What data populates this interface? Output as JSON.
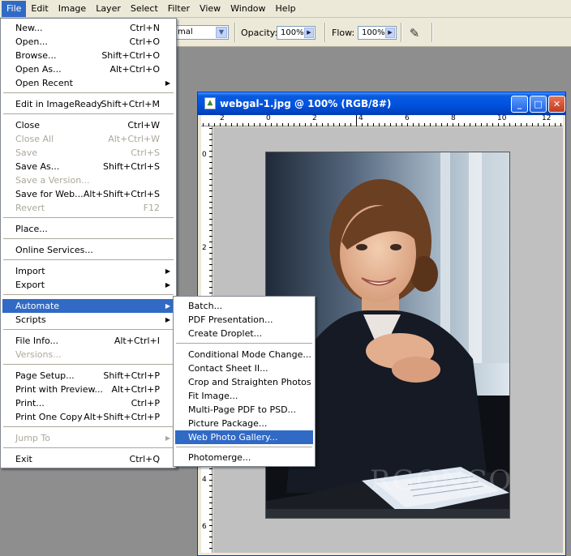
{
  "menubar": [
    "File",
    "Edit",
    "Image",
    "Layer",
    "Select",
    "Filter",
    "View",
    "Window",
    "Help"
  ],
  "options": {
    "mode_value": "mal",
    "opacity_label": "Opacity:",
    "opacity_value": "100%",
    "flow_label": "Flow:",
    "flow_value": "100%"
  },
  "document": {
    "title": "webgal-1.jpg @ 100% (RGB/8#)",
    "ruler_top": [
      "2",
      "0",
      "2",
      "4",
      "6",
      "8",
      "10",
      "12"
    ],
    "ruler_left": [
      "0",
      "2",
      "4",
      "6"
    ],
    "watermark": "RGONCO.COM"
  },
  "file_menu": {
    "g1": [
      {
        "label": "New...",
        "shortcut": "Ctrl+N"
      },
      {
        "label": "Open...",
        "shortcut": "Ctrl+O"
      },
      {
        "label": "Browse...",
        "shortcut": "Shift+Ctrl+O"
      },
      {
        "label": "Open As...",
        "shortcut": "Alt+Ctrl+O"
      },
      {
        "label": "Open Recent",
        "shortcut": ""
      }
    ],
    "g2": [
      {
        "label": "Edit in ImageReady",
        "shortcut": "Shift+Ctrl+M"
      }
    ],
    "g3": [
      {
        "label": "Close",
        "shortcut": "Ctrl+W"
      },
      {
        "label": "Close All",
        "shortcut": "Alt+Ctrl+W"
      },
      {
        "label": "Save",
        "shortcut": "Ctrl+S"
      },
      {
        "label": "Save As...",
        "shortcut": "Shift+Ctrl+S"
      },
      {
        "label": "Save a Version...",
        "shortcut": ""
      },
      {
        "label": "Save for Web...",
        "shortcut": "Alt+Shift+Ctrl+S"
      },
      {
        "label": "Revert",
        "shortcut": "F12"
      }
    ],
    "g4": [
      {
        "label": "Place...",
        "shortcut": ""
      }
    ],
    "g5": [
      {
        "label": "Online Services...",
        "shortcut": ""
      }
    ],
    "g6": [
      {
        "label": "Import",
        "shortcut": ""
      },
      {
        "label": "Export",
        "shortcut": ""
      }
    ],
    "g7": [
      {
        "label": "Automate",
        "shortcut": ""
      },
      {
        "label": "Scripts",
        "shortcut": ""
      }
    ],
    "g8": [
      {
        "label": "File Info...",
        "shortcut": "Alt+Ctrl+I"
      },
      {
        "label": "Versions...",
        "shortcut": ""
      }
    ],
    "g9": [
      {
        "label": "Page Setup...",
        "shortcut": "Shift+Ctrl+P"
      },
      {
        "label": "Print with Preview...",
        "shortcut": "Alt+Ctrl+P"
      },
      {
        "label": "Print...",
        "shortcut": "Ctrl+P"
      },
      {
        "label": "Print One Copy",
        "shortcut": "Alt+Shift+Ctrl+P"
      }
    ],
    "g10": [
      {
        "label": "Jump To",
        "shortcut": ""
      }
    ],
    "g11": [
      {
        "label": "Exit",
        "shortcut": "Ctrl+Q"
      }
    ]
  },
  "automate_menu": {
    "g1": [
      "Batch...",
      "PDF Presentation...",
      "Create Droplet..."
    ],
    "g2": [
      "Conditional Mode Change...",
      "Contact Sheet II...",
      "Crop and Straighten Photos",
      "Fit Image...",
      "Multi-Page PDF to PSD...",
      "Picture Package...",
      "Web Photo Gallery..."
    ],
    "g3": [
      "Photomerge..."
    ]
  }
}
